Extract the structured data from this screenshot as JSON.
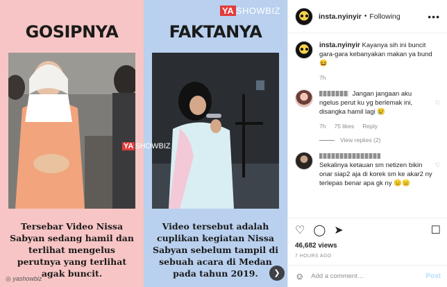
{
  "media": {
    "brand": {
      "ya": "YA",
      "showbiz": "SHOWBIZ"
    },
    "watermark": {
      "ya": "YA",
      "showbiz": "SHOWBIZ"
    },
    "left": {
      "title": "GOSIPNYA",
      "caption": "Tersebar Video Nissa Sabyan sedang hamil dan terlihat mengelus perutnya yang terlihat agak buncit."
    },
    "right": {
      "title": "FAKTANYA",
      "caption": "Video tersebut adalah cuplikan kegiatan Nissa Sabyan sebelum tampil di sebuah acara di Medan pada tahun 2019."
    },
    "handle": "yashowbiz",
    "next_icon": "chevron-right-icon"
  },
  "header": {
    "username": "insta.nyinyir",
    "dot": "•",
    "follow_label": "Following",
    "more_icon": "more-horizontal-icon"
  },
  "caption_comment": {
    "username": "insta.nyinyir",
    "text": "Kayanya sih ini buncit gara-gara kebanyakan makan ya bund 😆",
    "time": "7h"
  },
  "comments": [
    {
      "text": "Jangan jangaan aku ngelus perut ku yg berlemak ini, disangka hamil lagi 😢",
      "time": "7h",
      "likes": "75 likes",
      "reply": "Reply"
    },
    {
      "text": "Sekalinya ketauan sm netizen bikin onar siap2 aja di korek sm ke akar2 ny terlepas benar apa gk ny 😑😑"
    }
  ],
  "view_replies": "View replies (2)",
  "likes_count": "46,682 views",
  "timestamp": "7 HOURS AGO",
  "add_comment": {
    "placeholder": "Add a comment…",
    "post_label": "Post"
  },
  "colors": {
    "left_panel": "#f7c5c5",
    "right_panel": "#b9d0ee",
    "brand_red": "#e33b3b",
    "post_button": "#b2dffc"
  }
}
